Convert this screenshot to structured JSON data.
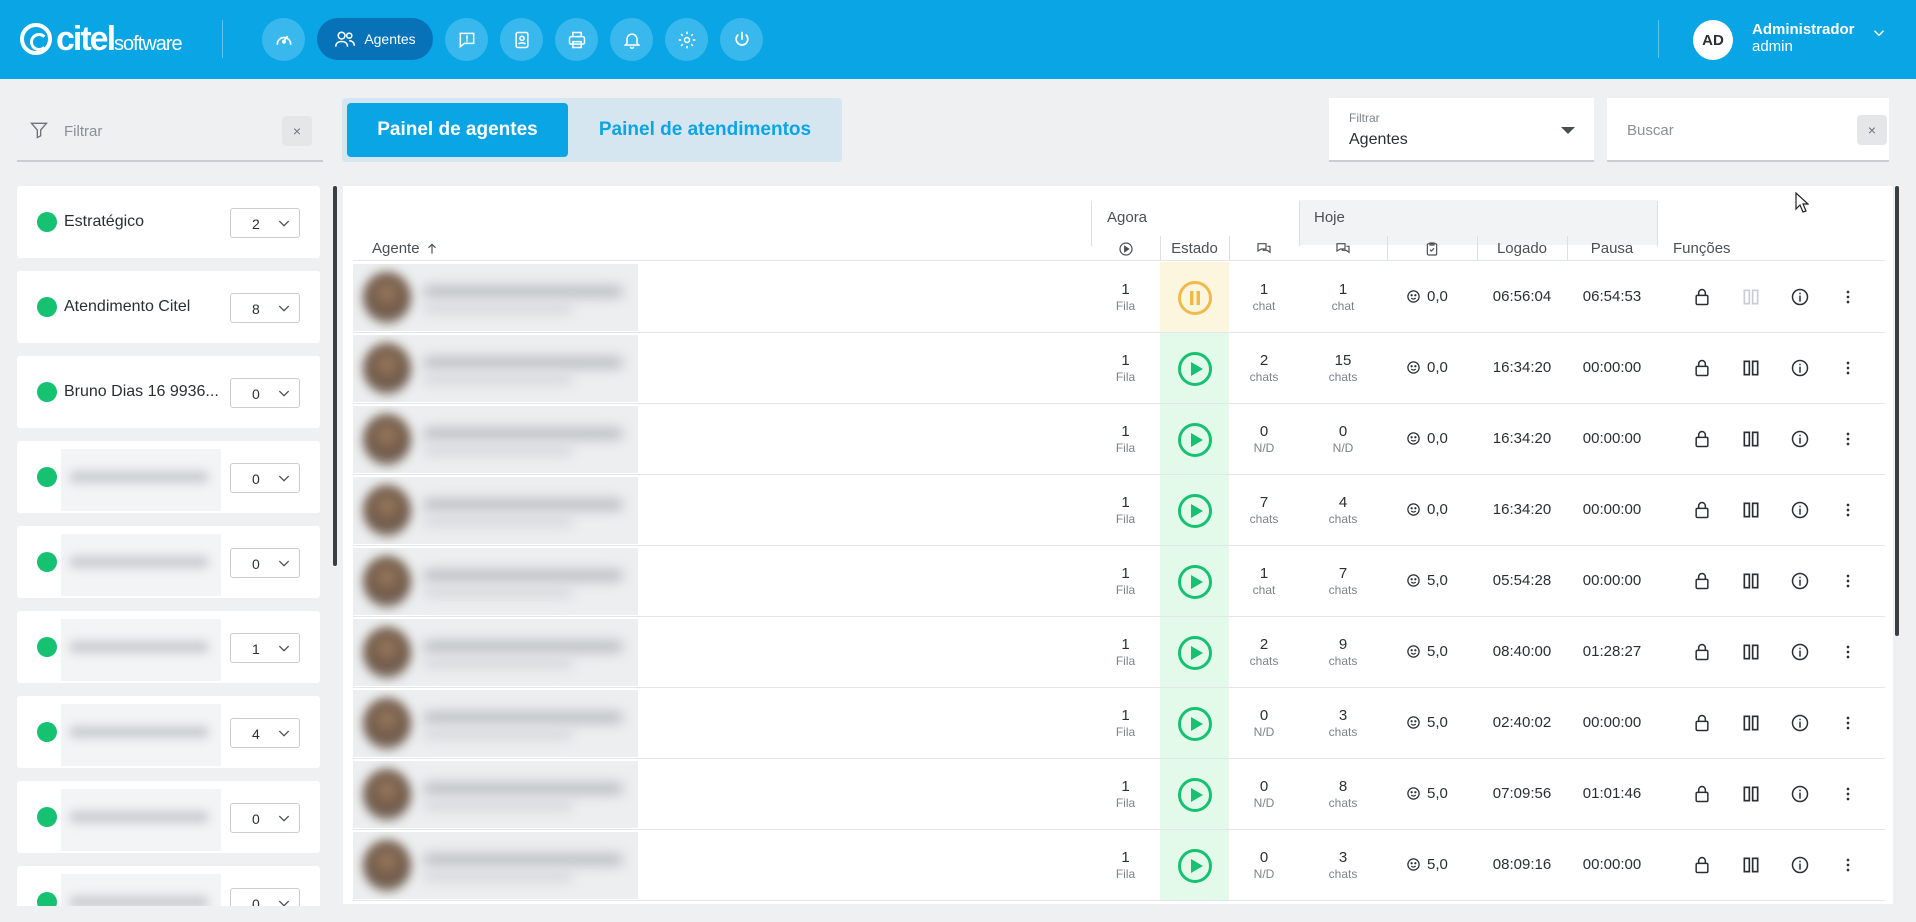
{
  "header": {
    "logo_brand": "citel",
    "logo_sub": "software",
    "nav": [
      {
        "icon": "speedometer-icon"
      },
      {
        "label": "Agentes",
        "icon": "users-icon",
        "active": true
      },
      {
        "icon": "chat-alert-icon"
      },
      {
        "icon": "contacts-book-icon"
      },
      {
        "icon": "printer-icon"
      },
      {
        "icon": "bell-icon"
      },
      {
        "icon": "gear-icon"
      },
      {
        "icon": "power-icon"
      }
    ],
    "user": {
      "initials": "AD",
      "name": "Administrador",
      "role": "admin"
    }
  },
  "filters": {
    "left_placeholder": "Filtrar",
    "clear_symbol": "×",
    "select_label": "Filtrar",
    "select_value": "Agentes",
    "search_placeholder": "Buscar"
  },
  "tabs": {
    "active": "Painel de agentes",
    "inactive": "Painel de atendimentos"
  },
  "queues": [
    {
      "name": "Estratégico",
      "count": "2",
      "blurred": false
    },
    {
      "name": "Atendimento Citel",
      "count": "8",
      "blurred": false
    },
    {
      "name": "Bruno Dias 16 9936...",
      "count": "0",
      "blurred": false
    },
    {
      "name": "",
      "count": "0",
      "blurred": true
    },
    {
      "name": "",
      "count": "0",
      "blurred": true
    },
    {
      "name": "",
      "count": "1",
      "blurred": true
    },
    {
      "name": "",
      "count": "4",
      "blurred": true
    },
    {
      "name": "",
      "count": "0",
      "blurred": true
    },
    {
      "name": "",
      "count": "0",
      "blurred": true
    }
  ],
  "table": {
    "group_now": "Agora",
    "group_today": "Hoje",
    "col_agent": "Agente",
    "col_state": "Estado",
    "col_logged": "Logado",
    "col_pause": "Pausa",
    "col_functions": "Funções",
    "icons": {
      "queue": "play-circle-icon",
      "chats_now": "chat-bubbles-icon",
      "chats_today": "chat-bubbles-icon",
      "survey": "clipboard-check-icon",
      "sort": "arrow-up-icon",
      "rating": "smiley-icon",
      "lock": "lock-icon",
      "columns": "columns-icon",
      "info": "info-icon",
      "more": "dots-vertical-icon"
    },
    "state_colors": {
      "active": "#16c172",
      "paused": "#f1b94a"
    },
    "rows": [
      {
        "queue": "1",
        "queue_unit": "Fila",
        "state": "paused",
        "now": "1",
        "now_unit": "chat",
        "today": "1",
        "today_unit": "chat",
        "rating": "0,0",
        "logged": "06:56:04",
        "pause": "06:54:53"
      },
      {
        "queue": "1",
        "queue_unit": "Fila",
        "state": "active",
        "now": "2",
        "now_unit": "chats",
        "today": "15",
        "today_unit": "chats",
        "rating": "0,0",
        "logged": "16:34:20",
        "pause": "00:00:00"
      },
      {
        "queue": "1",
        "queue_unit": "Fila",
        "state": "active",
        "now": "0",
        "now_unit": "N/D",
        "today": "0",
        "today_unit": "N/D",
        "rating": "0,0",
        "logged": "16:34:20",
        "pause": "00:00:00"
      },
      {
        "queue": "1",
        "queue_unit": "Fila",
        "state": "active",
        "now": "7",
        "now_unit": "chats",
        "today": "4",
        "today_unit": "chats",
        "rating": "0,0",
        "logged": "16:34:20",
        "pause": "00:00:00"
      },
      {
        "queue": "1",
        "queue_unit": "Fila",
        "state": "active",
        "now": "1",
        "now_unit": "chat",
        "today": "7",
        "today_unit": "chats",
        "rating": "5,0",
        "logged": "05:54:28",
        "pause": "00:00:00"
      },
      {
        "queue": "1",
        "queue_unit": "Fila",
        "state": "active",
        "now": "2",
        "now_unit": "chats",
        "today": "9",
        "today_unit": "chats",
        "rating": "5,0",
        "logged": "08:40:00",
        "pause": "01:28:27"
      },
      {
        "queue": "1",
        "queue_unit": "Fila",
        "state": "active",
        "now": "0",
        "now_unit": "N/D",
        "today": "3",
        "today_unit": "chats",
        "rating": "5,0",
        "logged": "02:40:02",
        "pause": "00:00:00"
      },
      {
        "queue": "1",
        "queue_unit": "Fila",
        "state": "active",
        "now": "0",
        "now_unit": "N/D",
        "today": "8",
        "today_unit": "chats",
        "rating": "5,0",
        "logged": "07:09:56",
        "pause": "01:01:46"
      },
      {
        "queue": "1",
        "queue_unit": "Fila",
        "state": "active",
        "now": "0",
        "now_unit": "N/D",
        "today": "3",
        "today_unit": "chats",
        "rating": "5,0",
        "logged": "08:09:16",
        "pause": "00:00:00"
      }
    ]
  }
}
